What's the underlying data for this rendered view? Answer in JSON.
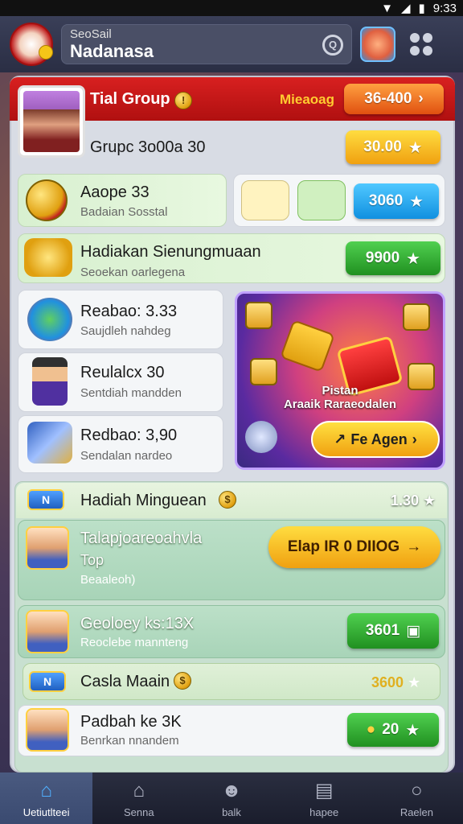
{
  "status": {
    "time": "9:33"
  },
  "topbar": {
    "search_small": "SeoSail",
    "search_main": "Nadanasa",
    "search_icon": "search-icon"
  },
  "header": {
    "title": "Tial Group",
    "subtitle": "Mieaoag",
    "button_label": "36-400"
  },
  "profile_row": {
    "title": "Grupc 3o00a 30",
    "button_label": "30.00"
  },
  "row_aaope": {
    "title": "Aaope 33",
    "subtitle": "Badaian Sosstal",
    "button_label": "3060"
  },
  "row_hadiakan": {
    "title": "Hadiakan Sienungmuaan",
    "subtitle": "Seoekan oarlegena",
    "button_label": "9900"
  },
  "list": [
    {
      "title": "Reabao: 3.33",
      "subtitle": "Saujdleh nahdeg"
    },
    {
      "title": "Reulalcx 30",
      "subtitle": "Sentdiah mandden"
    },
    {
      "title": "Redbao: 3,90",
      "subtitle": "Sendalan nardeo"
    }
  ],
  "promo": {
    "label1": "Pistan",
    "label2": "Araaik Raraeodalen",
    "button_label": "Fe Agen"
  },
  "weekly": {
    "title": "Hadiah Minguean",
    "value": "1.30",
    "tab_label": "N"
  },
  "featured": {
    "title": "Talapjoareoahvla",
    "line2": "Top",
    "line3": "Beaaleoh)",
    "button_label": "Elap IR 0 DIIOG"
  },
  "row_geoloey": {
    "title": "Geoloey ks:13X",
    "subtitle": "Reoclebe mannteng",
    "button_label": "3601"
  },
  "casla": {
    "title": "Casla Maain",
    "value": "3600",
    "tab_label": "N"
  },
  "row_padbah": {
    "title": "Padbah ke 3K",
    "subtitle": "Benrkan nnandem",
    "button_label": "20"
  },
  "nav": [
    {
      "label": "Uetiutlteei",
      "icon": "home-icon"
    },
    {
      "label": "Senna",
      "icon": "house-icon"
    },
    {
      "label": "balk",
      "icon": "face-icon"
    },
    {
      "label": "hapee",
      "icon": "briefcase-icon"
    },
    {
      "label": "Raelen",
      "icon": "circle-icon"
    }
  ]
}
